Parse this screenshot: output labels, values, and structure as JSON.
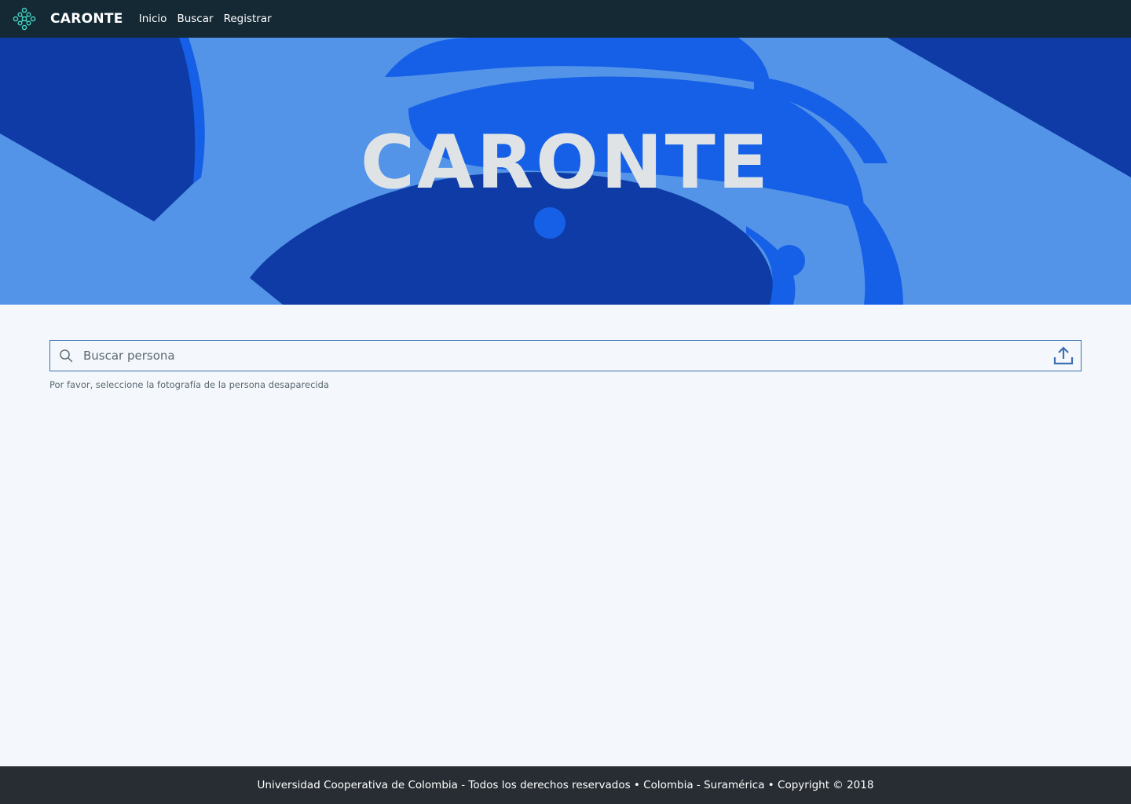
{
  "header": {
    "brand": "CARONTE",
    "logo_icon": "molecule-network-icon",
    "nav": [
      {
        "label": "Inicio"
      },
      {
        "label": "Buscar"
      },
      {
        "label": "Registrar"
      }
    ]
  },
  "hero": {
    "title": "CARONTE"
  },
  "search": {
    "placeholder": "Buscar persona",
    "value": "",
    "search_icon": "search-icon",
    "upload_icon": "upload-icon",
    "helper": "Por favor, seleccione la fotografía de la persona desaparecida"
  },
  "footer": {
    "text": "Universidad Cooperativa de Colombia - Todos los derechos reservados • Colombia - Suramérica • Copyright © 2018"
  },
  "colors": {
    "topbar": "#152935",
    "hero_light": "#5394e8",
    "hero_mid": "#1660e8",
    "hero_dark": "#0e3ba5",
    "accent_teal": "#41d6c3",
    "search_border": "#3d70b2",
    "footer": "#272d33",
    "page_bg": "#f4f7fb"
  }
}
